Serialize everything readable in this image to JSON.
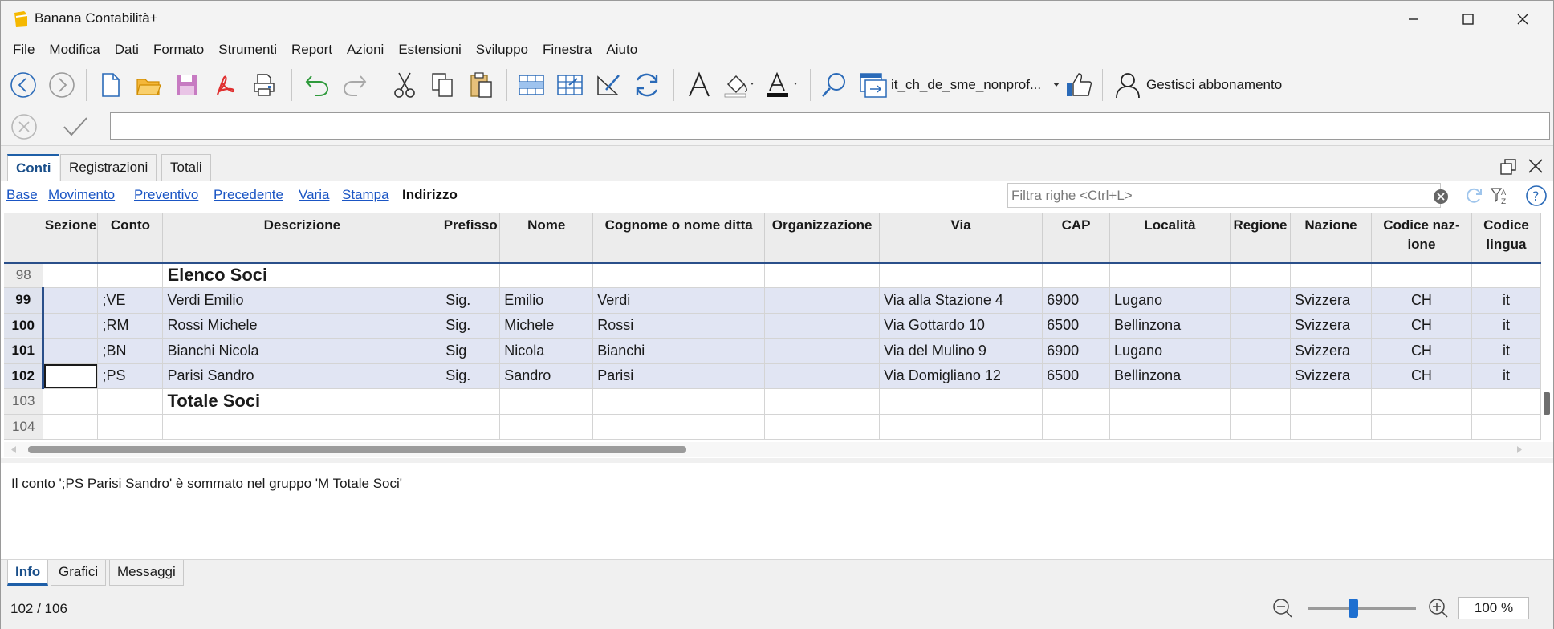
{
  "app": {
    "title": "Banana Contabilità+"
  },
  "menu": [
    "File",
    "Modifica",
    "Dati",
    "Formato",
    "Strumenti",
    "Report",
    "Azioni",
    "Estensioni",
    "Sviluppo",
    "Finestra",
    "Aiuto"
  ],
  "toolbar": {
    "file_name": "it_ch_de_sme_nonprof...",
    "subscription": "Gestisci abbonamento"
  },
  "tabs": [
    "Conti",
    "Registrazioni",
    "Totali"
  ],
  "views": {
    "links": [
      "Base",
      "Movimento",
      "Preventivo",
      "Precedente",
      "Varia",
      "Stampa"
    ],
    "active": "Indirizzo"
  },
  "filter": {
    "placeholder": "Filtra righe <Ctrl+L>"
  },
  "table": {
    "headers": [
      "",
      "Sezione",
      "Conto",
      "Descrizione",
      "Prefisso",
      "Nome",
      "Cognome o nome ditta",
      "Organizzazione",
      "Via",
      "CAP",
      "Località",
      "Regione",
      "Nazione",
      "Codice naz-\nione",
      "Codice\nlingua"
    ],
    "rows": [
      {
        "n": "98",
        "sezione": "",
        "conto": "",
        "desc": "Elenco Soci",
        "prefisso": "",
        "nome": "",
        "cognome": "",
        "org": "",
        "via": "",
        "cap": "",
        "loc": "",
        "reg": "",
        "naz": "",
        "cod": "",
        "lingua": ""
      },
      {
        "n": "99",
        "sezione": "",
        "conto": ";VE",
        "desc": "Verdi Emilio",
        "prefisso": "Sig.",
        "nome": "Emilio",
        "cognome": "Verdi",
        "org": "",
        "via": "Via alla Stazione 4",
        "cap": "6900",
        "loc": "Lugano",
        "reg": "",
        "naz": "Svizzera",
        "cod": "CH",
        "lingua": "it"
      },
      {
        "n": "100",
        "sezione": "",
        "conto": ";RM",
        "desc": "Rossi Michele",
        "prefisso": "Sig.",
        "nome": "Michele",
        "cognome": "Rossi",
        "org": "",
        "via": "Via Gottardo 10",
        "cap": "6500",
        "loc": "Bellinzona",
        "reg": "",
        "naz": "Svizzera",
        "cod": "CH",
        "lingua": "it"
      },
      {
        "n": "101",
        "sezione": "",
        "conto": ";BN",
        "desc": "Bianchi Nicola",
        "prefisso": "Sig",
        "nome": "Nicola",
        "cognome": "Bianchi",
        "org": "",
        "via": "Via del Mulino 9",
        "cap": "6900",
        "loc": "Lugano",
        "reg": "",
        "naz": "Svizzera",
        "cod": "CH",
        "lingua": "it"
      },
      {
        "n": "102",
        "sezione": "",
        "conto": ";PS",
        "desc": "Parisi Sandro",
        "prefisso": "Sig.",
        "nome": "Sandro",
        "cognome": "Parisi",
        "org": "",
        "via": "Via Domigliano 12",
        "cap": "6500",
        "loc": "Bellinzona",
        "reg": "",
        "naz": "Svizzera",
        "cod": "CH",
        "lingua": "it"
      },
      {
        "n": "103",
        "sezione": "",
        "conto": "",
        "desc": "Totale Soci",
        "prefisso": "",
        "nome": "",
        "cognome": "",
        "org": "",
        "via": "",
        "cap": "",
        "loc": "",
        "reg": "",
        "naz": "",
        "cod": "",
        "lingua": ""
      },
      {
        "n": "104",
        "sezione": "",
        "conto": "",
        "desc": "",
        "prefisso": "",
        "nome": "",
        "cognome": "",
        "org": "",
        "via": "",
        "cap": "",
        "loc": "",
        "reg": "",
        "naz": "",
        "cod": "",
        "lingua": ""
      }
    ]
  },
  "info": {
    "message": "Il conto ';PS Parisi Sandro' è sommato nel gruppo 'M Totale Soci'"
  },
  "bottom_tabs": [
    "Info",
    "Grafici",
    "Messaggi"
  ],
  "status": {
    "position": "102 / 106",
    "zoom": "100 %",
    "zoom_fraction": 0.42
  },
  "colors": {
    "accent": "#1e5fa8",
    "selected_row": "#e1e5f3",
    "link": "#1a55c4"
  }
}
